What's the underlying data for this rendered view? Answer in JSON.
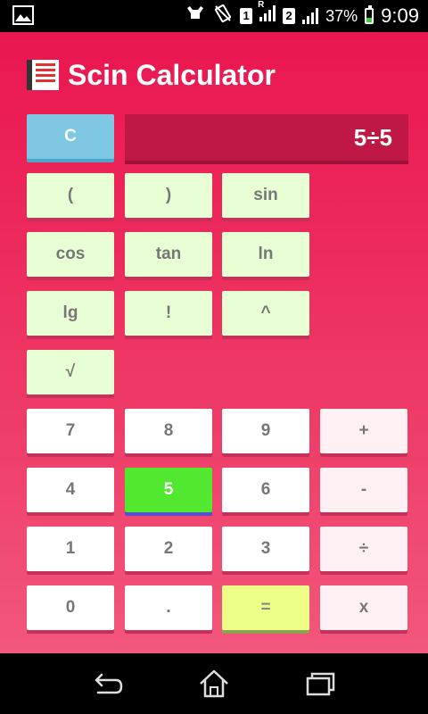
{
  "status_bar": {
    "sim1": "1",
    "sim2": "2",
    "roaming": "R",
    "battery_percent": "37%",
    "battery_level": 0.37,
    "time": "9:09"
  },
  "app": {
    "title": "Scin Calculator",
    "display_value": "5÷5"
  },
  "buttons": {
    "clear": "C",
    "open_paren": "(",
    "close_paren": ")",
    "sin": "sin",
    "cos": "cos",
    "tan": "tan",
    "ln": "ln",
    "lg": "lg",
    "factorial": "!",
    "power": "^",
    "sqrt": "√",
    "seven": "7",
    "eight": "8",
    "nine": "9",
    "plus": "+",
    "four": "4",
    "five": "5",
    "six": "6",
    "minus": "-",
    "one": "1",
    "two": "2",
    "three": "3",
    "divide": "÷",
    "zero": "0",
    "dot": ".",
    "equals": "=",
    "multiply": "x"
  },
  "colors": {
    "background_top": "#ea164f",
    "background_bottom": "#f2577c",
    "display": "#c01845",
    "clear_button": "#7ec8e3",
    "function_button": "#e8ffd6",
    "active_button": "#52e830",
    "equals_button": "#eeff88"
  },
  "icons": {
    "gallery": "image-icon",
    "app": "calculator-app-icon",
    "back": "back-icon",
    "home": "home-icon",
    "recents": "recents-icon"
  }
}
